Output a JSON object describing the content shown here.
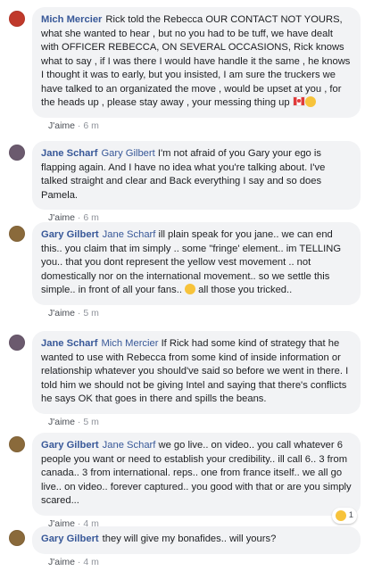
{
  "comments": [
    {
      "author": "Mich Mercier",
      "mention": "",
      "text": "Rick told the Rebecca OUR CONTACT NOT YOURS, what she wanted to hear , but no you had to be tuff, we have dealt with OFFICER REBECCA, ON SEVERAL OCCASIONS, Rick knows what to say , if I was there I would have handle it the same , he knows I thought it was to early, but you insisted, I am sure the truckers we have talked to an organizated the move , would be upset at you , for the heads up , please stay away , your messing thing up",
      "like_label": "J'aime",
      "time": "6 m",
      "avatar_color": "#c0392b",
      "icons": [
        "canada-flag-icon",
        "laughing-emoji-icon"
      ]
    },
    {
      "author": "Jane Scharf",
      "mention": "Gary Gilbert",
      "text": "I'm not afraid of you Gary your ego is flapping again. And I have no idea what you're talking about. I've talked straight and clear and Back everything I say and so does Pamela.",
      "like_label": "J'aime",
      "time": "6 m",
      "avatar_color": "#6b5a6e"
    },
    {
      "author": "Gary Gilbert",
      "mention": "Jane Scharf",
      "text": "ill plain speak for you jane.. we can end this.. you claim that im simply .. some \"fringe' element.. im TELLING you.. that you dont represent the yellow vest movement .. not domestically nor on the international movement.. so we settle this simple.. in front of all your fans..",
      "text_after": "all those you tricked..",
      "like_label": "J'aime",
      "time": "5 m",
      "avatar_color": "#8a6a3b",
      "icons": [
        "smiley-emoji-icon"
      ]
    },
    {
      "author": "Jane Scharf",
      "mention": "Mich Mercier",
      "text": "If Rick had some kind of strategy that he wanted to use with Rebecca from some kind of inside information or relationship whatever you should've said so before we went in there. I told him we should not be giving Intel and saying that there's conflicts he says OK that goes in there and spills the beans.",
      "like_label": "J'aime",
      "time": "5 m",
      "avatar_color": "#6b5a6e"
    },
    {
      "author": "Gary Gilbert",
      "mention": "Jane Scharf",
      "text": "we go live.. on video.. you call whatever 6 people you want or need to establish your credibility.. ill call 6.. 3 from canada.. 3 from international. reps.. one from france itself.. we all go live.. on video.. forever captured.. you good with that or are you simply scared...",
      "like_label": "J'aime",
      "time": "4 m",
      "avatar_color": "#8a6a3b",
      "reaction_count": "1",
      "reaction_icon": "laughing-emoji-icon"
    },
    {
      "author": "Gary Gilbert",
      "mention": "",
      "text": "they will give my bonafides.. will yours?",
      "like_label": "J'aime",
      "time": "4 m",
      "avatar_color": "#8a6a3b"
    }
  ]
}
